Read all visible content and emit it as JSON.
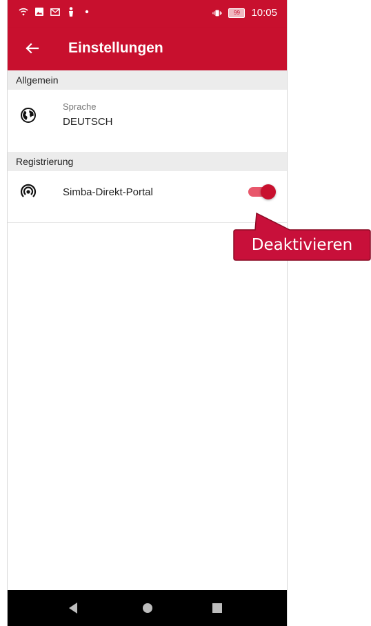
{
  "status_bar": {
    "time": "10:05",
    "battery": "99",
    "icons": [
      "wifi-icon",
      "image-icon",
      "gmail-icon",
      "figure-icon",
      "dot-icon",
      "vibrate-icon",
      "battery-icon"
    ]
  },
  "app_bar": {
    "title": "Einstellungen",
    "back_icon": "arrow-left-icon"
  },
  "sections": [
    {
      "header": "Allgemein",
      "items": [
        {
          "icon": "globe-icon",
          "label": "Sprache",
          "value": "DEUTSCH"
        }
      ]
    },
    {
      "header": "Registrierung",
      "items": [
        {
          "icon": "wireless-icon",
          "label": "Simba-Direkt-Portal",
          "toggle_on": true
        }
      ]
    }
  ],
  "callout": {
    "text": "Deaktivieren"
  },
  "nav_bar": {
    "icons": [
      "nav-back-icon",
      "nav-home-icon",
      "nav-recents-icon"
    ]
  },
  "colors": {
    "primary": "#c8102e",
    "toggle_track": "#e8576b",
    "section_bg": "#ececec",
    "callout_bg": "#c8103a"
  }
}
